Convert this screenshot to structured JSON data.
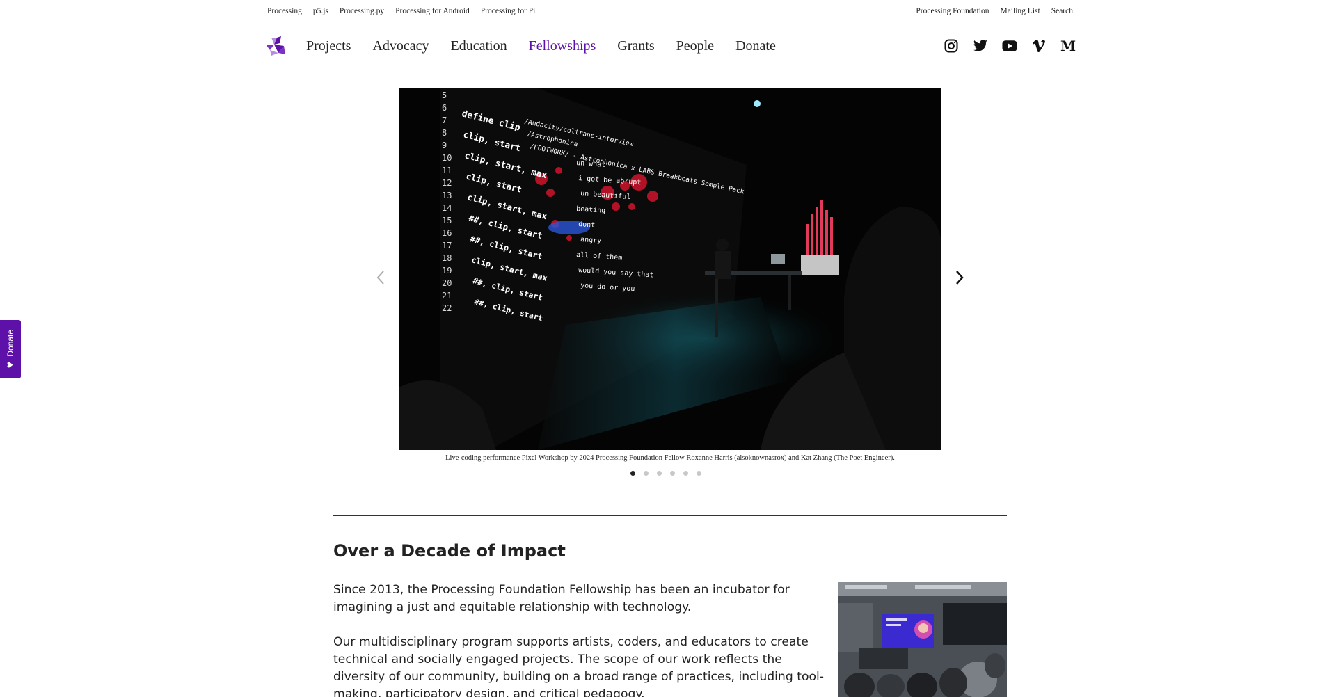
{
  "topbar": {
    "left_links": [
      "Processing",
      "p5.js",
      "Processing.py",
      "Processing for Android",
      "Processing for Pi"
    ],
    "right_links": [
      "Processing Foundation",
      "Mailing List",
      "Search"
    ]
  },
  "nav": {
    "items": [
      {
        "label": "Projects",
        "active": false
      },
      {
        "label": "Advocacy",
        "active": false
      },
      {
        "label": "Education",
        "active": false
      },
      {
        "label": "Fellowships",
        "active": true
      },
      {
        "label": "Grants",
        "active": false
      },
      {
        "label": "People",
        "active": false
      },
      {
        "label": "Donate",
        "active": false
      }
    ],
    "social_icons": [
      "instagram-icon",
      "twitter-icon",
      "youtube-icon",
      "vimeo-icon",
      "medium-icon"
    ],
    "medium_glyph": "M"
  },
  "donate_tab": {
    "label": "Donate",
    "heart": "♥"
  },
  "carousel": {
    "caption": "Live-coding performance Pixel Workshop by 2024 Processing Foundation Fellow Roxanne Harris (alsoknownasrox) and Kat Zhang (The Poet Engineer).",
    "slide_count": 6,
    "active_index": 0,
    "code_lines": [
      "define clip",
      "clip, start",
      "clip, start, max",
      "clip, start",
      "clip, start, max",
      "##, clip, start",
      "##, clip, start",
      "clip, start, max",
      "##, clip, start",
      "##, clip, start"
    ],
    "line_numbers": [
      "5",
      "6",
      "7",
      "8",
      "9",
      "10",
      "11",
      "12",
      "13",
      "14",
      "15",
      "16",
      "17",
      "18",
      "19",
      "20",
      "21",
      "22"
    ],
    "overlay_text": [
      "/Audacity/coltrane-interview",
      "/Astrophonica",
      "/FOOTWORK/ - Astrophonica x LABS Breakbeats Sample Pack",
      "un what",
      "i got be abrupt",
      "un beautiful",
      "beating",
      "dont",
      "angry",
      "all of them",
      "would you say that",
      "you do or you"
    ]
  },
  "section": {
    "title": "Over a Decade of Impact",
    "paragraphs": [
      "Since 2013, the Processing Foundation Fellowship has been an incubator for imagining a just and equitable relationship with technology.",
      "Our multidisciplinary program supports artists, coders, and educators to create technical and socially engaged projects. The scope of our work reflects the diversity of our community, building on a broad range of practices, including tool-making, participatory design, and critical pedagogy."
    ]
  },
  "colors": {
    "accent": "#5e11a8",
    "text": "#222222",
    "divider": "#333333"
  }
}
